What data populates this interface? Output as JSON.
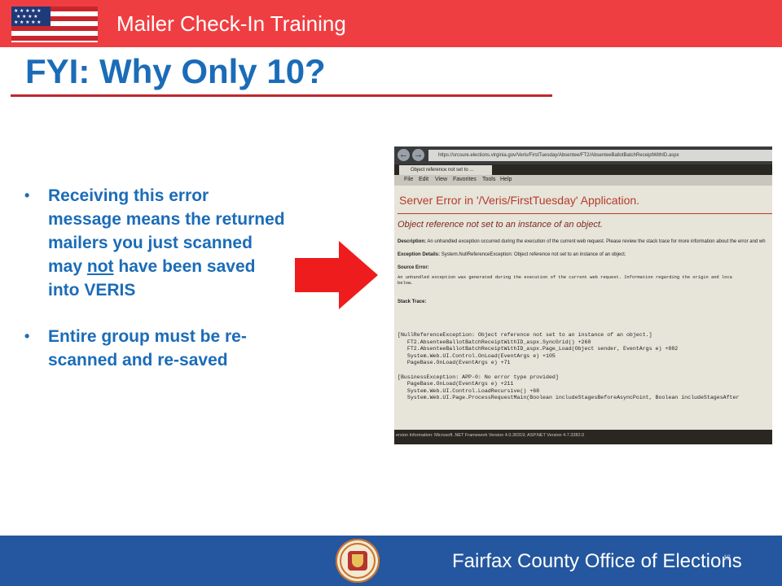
{
  "header": {
    "title": "Mailer Check-In Training",
    "flag_icon": "us-flag-icon"
  },
  "slide": {
    "title": "FYI:  Why Only 10?",
    "bullets": [
      {
        "pre": "Receiving this error message means the returned mailers you just scanned may ",
        "emphasis": "not",
        "post": " have been saved into VERIS"
      },
      {
        "pre": "Entire group must be re-scanned and re-saved",
        "emphasis": "",
        "post": ""
      }
    ],
    "bullet_glyph": "•",
    "arrow_icon": "right-arrow-icon"
  },
  "screenshot": {
    "url": "https://srcsure.elections.virginia.gov/Veris/FirstTuesday/Absentee/FT2/AbsenteeBallotBatchReceiptWithID.aspx",
    "tab": "Object reference not set to ...",
    "menu": [
      "File",
      "Edit",
      "View",
      "Favorites",
      "Tools",
      "Help"
    ],
    "error_title": "Server Error in '/Veris/FirstTuesday' Application.",
    "error_subtitle": "Object reference not set to an instance of an object.",
    "description_label": "Description:",
    "description": "An unhandled exception occurred during the execution of the current web request. Please review the stack trace for more information about the error and wh",
    "exception_label": "Exception Details:",
    "exception": "System.NullReferenceException: Object reference not set to an instance of an object.",
    "source_label": "Source Error:",
    "source": "An unhandled exception was generated during the execution of the current web request. Information regarding the origin and loca\nbelow.",
    "stack_label": "Stack Trace:",
    "trace": "[NullReferenceException: Object reference not set to an instance of an object.]\n   FT2.AbsenteeBallotBatchReceiptWithID_aspx.SyncGrid() +260\n   FT2.AbsenteeBallotBatchReceiptWithID_aspx.Page_Load(Object sender, EventArgs e) +882\n   System.Web.UI.Control.OnLoad(EventArgs e) +105\n   PageBase.OnLoad(EventArgs e) +71\n\n[BusinessException: APP-0: No error type provided]\n   PageBase.OnLoad(EventArgs e) +211\n   System.Web.UI.Control.LoadRecursive() +68\n   System.Web.UI.Page.ProcessRequestMain(Boolean includeStagesBeforeAsyncPoint, Boolean includeStagesAfter",
    "version": "ersion Information: Microsoft .NET Framework Version 4.0.30319; ASP.NET Version 4.7.3282.0"
  },
  "footer": {
    "organization": "Fairfax County Office of Elections",
    "seal_icon": "county-seal-icon",
    "page_number": "48"
  }
}
